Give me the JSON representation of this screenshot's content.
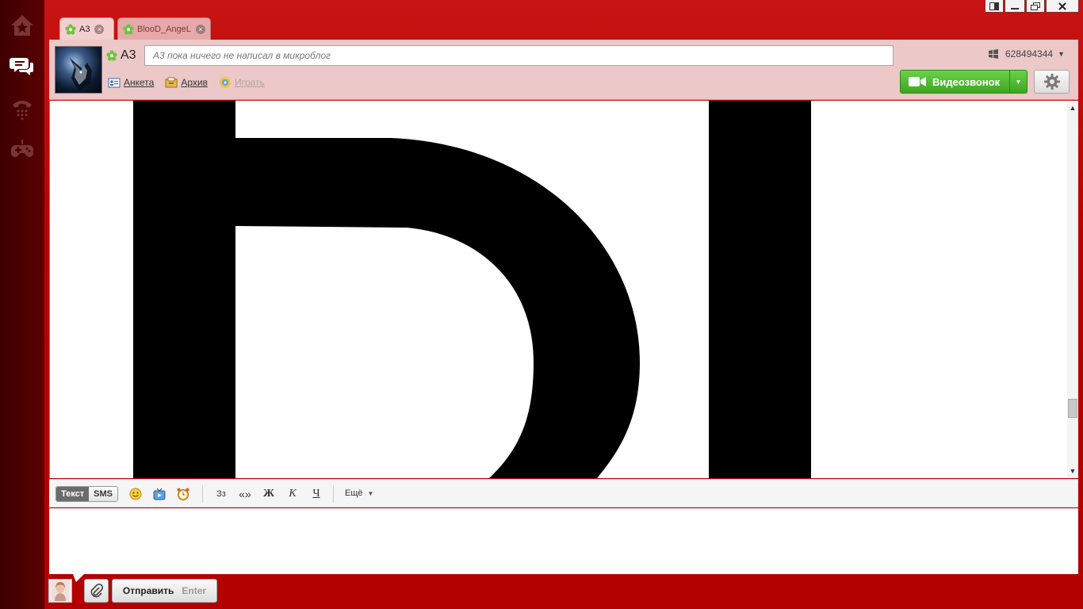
{
  "nav": {
    "items": [
      {
        "icon": "home-icon",
        "active": false
      },
      {
        "icon": "chat-icon",
        "active": true
      },
      {
        "icon": "phone-icon",
        "active": false
      },
      {
        "icon": "gamepad-icon",
        "active": false
      }
    ]
  },
  "window": {
    "controls": [
      "restore-icon",
      "minimize-icon",
      "maximize-icon",
      "close-icon"
    ]
  },
  "tabs": [
    {
      "label": "A3",
      "active": true
    },
    {
      "label": "BlooD_AngeL",
      "active": false
    }
  ],
  "header": {
    "contact_name": "A3",
    "microblog_placeholder": "A3 пока ничего не написал в микроблог",
    "uin": "628494344",
    "links": {
      "profile": "Анкета",
      "archive": "Архив",
      "play": "Играть"
    },
    "video_call_label": "Видеозвонок"
  },
  "toolbar": {
    "mode_text": "Текст",
    "mode_sms": "SMS",
    "translit_glyph": "Зз",
    "quotes_glyph": "«»",
    "bold_glyph": "Ж",
    "italic_glyph": "К",
    "underline_glyph": "Ч",
    "more_label": "Ещё"
  },
  "composer": {
    "text": ""
  },
  "send": {
    "label": "Отправить",
    "hint": "Enter"
  },
  "colors": {
    "frame": "#b80000",
    "rail": "#4a0000",
    "header_bg": "#ecc8c8",
    "video_green": "#4cb82c"
  }
}
